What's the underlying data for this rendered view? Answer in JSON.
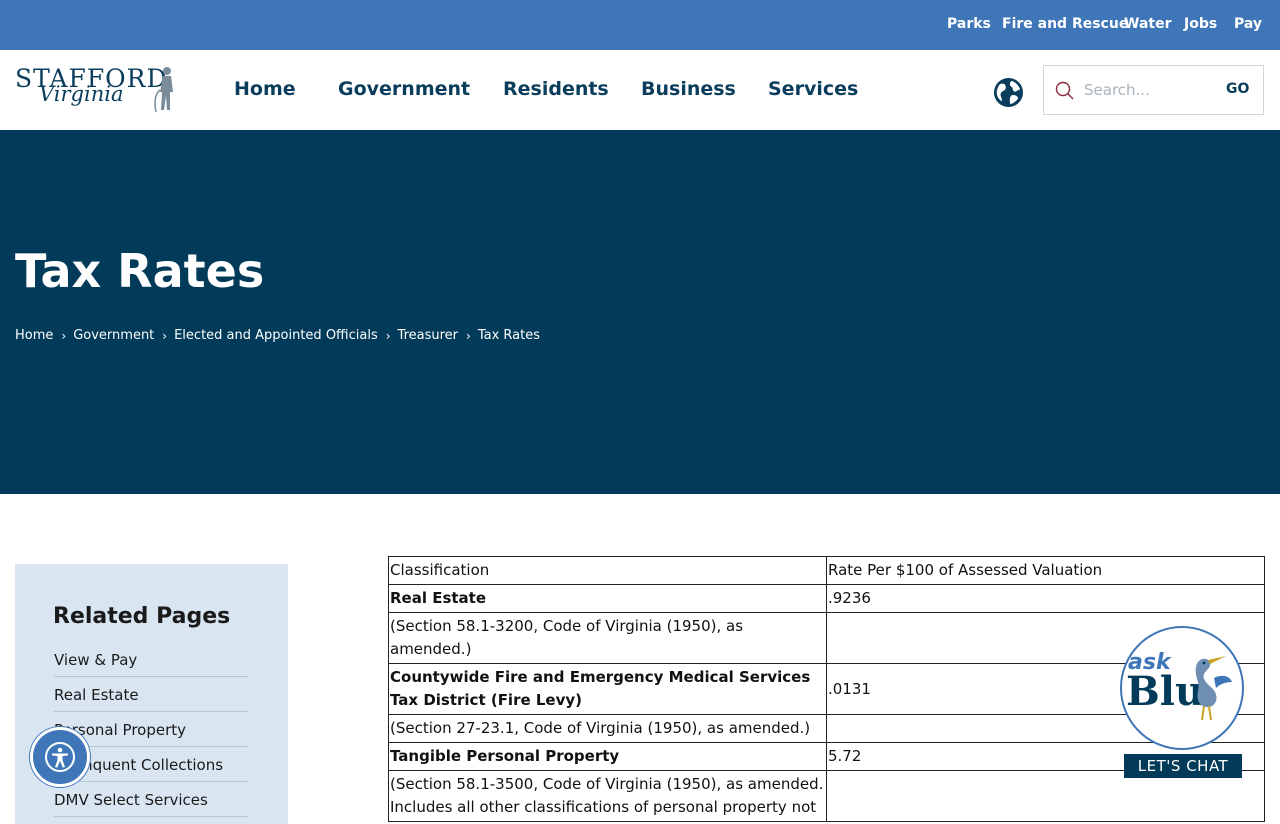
{
  "utility_nav": {
    "items": [
      {
        "label": "Parks"
      },
      {
        "label": "Fire and Rescue"
      },
      {
        "label": "Water"
      },
      {
        "label": "Jobs"
      },
      {
        "label": "Pay"
      }
    ]
  },
  "logo": {
    "line1": "STAFFORD",
    "line2": "Virginia"
  },
  "main_nav": {
    "items": [
      {
        "label": "Home"
      },
      {
        "label": "Government"
      },
      {
        "label": "Residents"
      },
      {
        "label": "Business"
      },
      {
        "label": "Services"
      }
    ]
  },
  "search": {
    "placeholder": "Search...",
    "go_label": "GO",
    "value": ""
  },
  "hero": {
    "title": "Tax Rates",
    "breadcrumb": [
      "Home",
      "Government",
      "Elected and Appointed Officials",
      "Treasurer",
      "Tax Rates"
    ],
    "separator": "›"
  },
  "sidebar": {
    "title": "Related Pages",
    "items": [
      "View & Pay",
      "Real Estate",
      "Personal Property",
      "Delinquent Collections",
      "DMV Select Services"
    ]
  },
  "tax_table": {
    "header": [
      "Classification",
      "Rate Per $100 of Assessed Valuation"
    ],
    "rows": [
      {
        "classification": "Real Estate",
        "rate": ".9236",
        "bold": true
      },
      {
        "classification": "(Section 58.1-3200, Code of Virginia (1950), as amended.)",
        "rate": "",
        "bold": false
      },
      {
        "classification": "Countywide Fire and Emergency Medical Services Tax District (Fire Levy)",
        "rate": ".0131",
        "bold": true
      },
      {
        "classification": "(Section 27-23.1, Code of Virginia (1950), as amended.)",
        "rate": "",
        "bold": false
      },
      {
        "classification": "Tangible Personal Property",
        "rate": "5.72",
        "bold": true
      },
      {
        "classification": "(Section 58.1-3500, Code of Virginia (1950), as amended. Includes all other classifications of personal property not",
        "rate": "",
        "bold": false
      }
    ]
  },
  "chat_widget": {
    "ask": "ask",
    "blu": "Blu",
    "cta": "LET'S CHAT"
  },
  "colors": {
    "top_bar": "#3f76b8",
    "hero": "#023b59",
    "nav_text": "#0a3d5c",
    "sidebar_bg": "#d9e6f2"
  },
  "icons": {
    "search": "search-icon",
    "globe": "globe-icon",
    "accessibility": "accessibility-icon"
  }
}
